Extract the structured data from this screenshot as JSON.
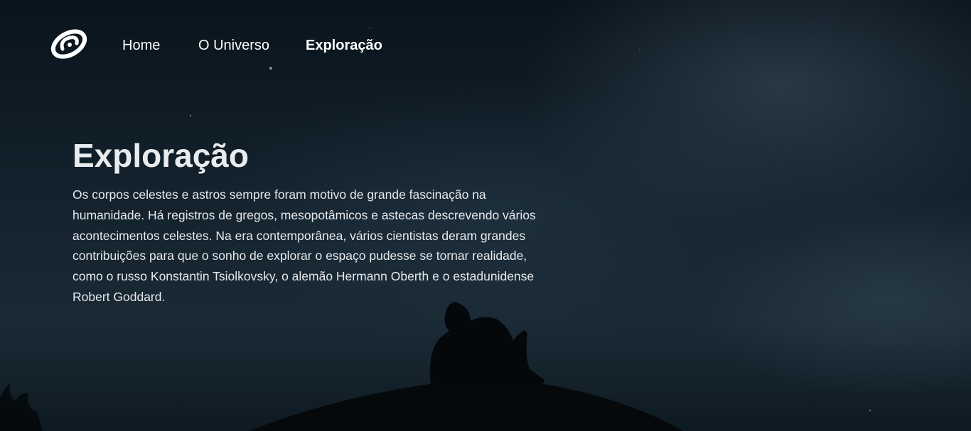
{
  "nav": {
    "logo_icon": "spiral-galaxy-icon",
    "items": [
      {
        "label": "Home",
        "active": false
      },
      {
        "label": "O Universo",
        "active": false
      },
      {
        "label": "Exploração",
        "active": true
      }
    ]
  },
  "hero": {
    "title": "Exploração",
    "body": "Os corpos celestes e astros sempre foram motivo de grande fascinação na humanidade. Há registros de gregos, mesopotâmicos e astecas descrevendo vários acontecimentos celestes. Na era contemporânea, vários cientistas deram grandes contribuições para que o sonho de explorar o espaço pudesse se tornar realidade, como o russo Konstantin Tsiolkovsky, o alemão Hermann Oberth e o estadunidense Robert Goddard."
  },
  "background": {
    "image": "night-sky-silhouette-person-on-hill",
    "colors": {
      "sky_dark": "#0a141c",
      "sky_mid": "#1a2a35",
      "silhouette": "#05090c"
    }
  }
}
